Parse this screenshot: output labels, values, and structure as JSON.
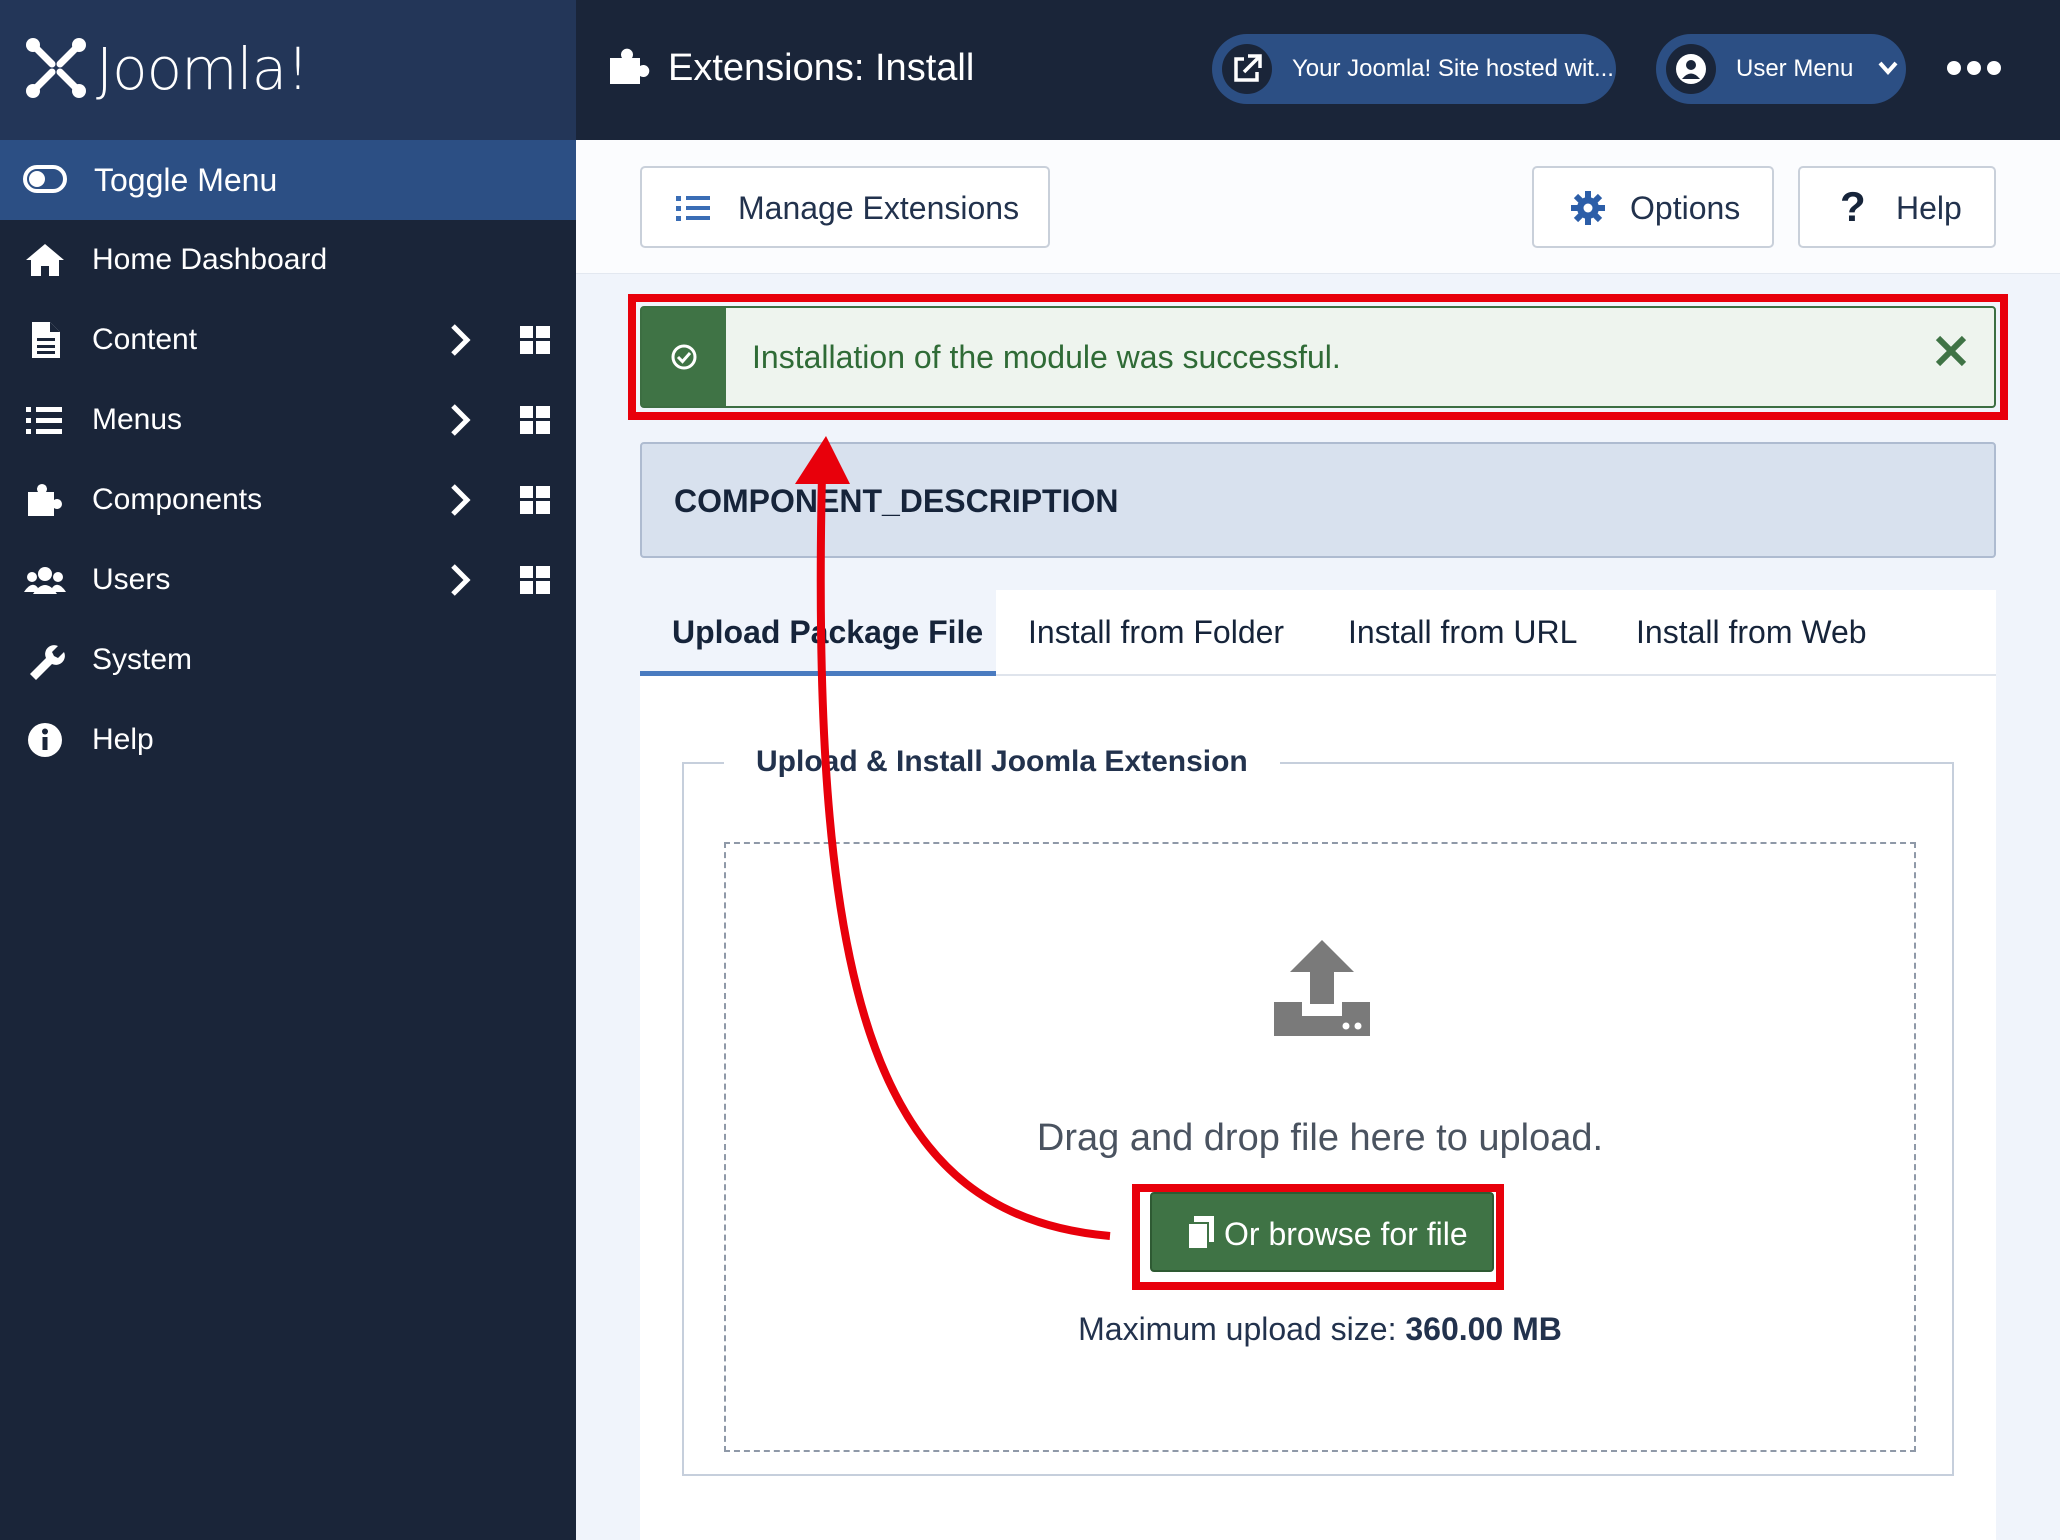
{
  "brand": {
    "logo_text": "Joomla!"
  },
  "sidebar": {
    "toggle_label": "Toggle Menu",
    "items": [
      {
        "label": "Home Dashboard",
        "icon": "home-icon"
      },
      {
        "label": "Content",
        "icon": "file-icon"
      },
      {
        "label": "Menus",
        "icon": "list-icon"
      },
      {
        "label": "Components",
        "icon": "puzzle-icon"
      },
      {
        "label": "Users",
        "icon": "users-icon"
      },
      {
        "label": "System",
        "icon": "wrench-icon"
      },
      {
        "label": "Help",
        "icon": "info-icon"
      }
    ]
  },
  "header": {
    "title": "Extensions: Install",
    "site_link": "Your Joomla! Site hosted wit...",
    "user_menu": "User Menu"
  },
  "toolbar": {
    "manage_label": "Manage Extensions",
    "options_label": "Options",
    "help_label": "Help"
  },
  "alert": {
    "message": "Installation of the module was successful."
  },
  "description": "COMPONENT_DESCRIPTION",
  "tabs": [
    {
      "label": "Upload Package File"
    },
    {
      "label": "Install from Folder"
    },
    {
      "label": "Install from URL"
    },
    {
      "label": "Install from Web"
    }
  ],
  "upload": {
    "legend": "Upload & Install Joomla Extension",
    "drag_text": "Drag and drop file here to upload.",
    "browse_label": "Or browse for file",
    "max_label": "Maximum upload size:",
    "max_value": "360.00 MB"
  },
  "colors": {
    "sidebar_bg": "#1a2539",
    "accent": "#2c4f84",
    "success": "#3f7345",
    "annotation_red": "#e8000b"
  }
}
